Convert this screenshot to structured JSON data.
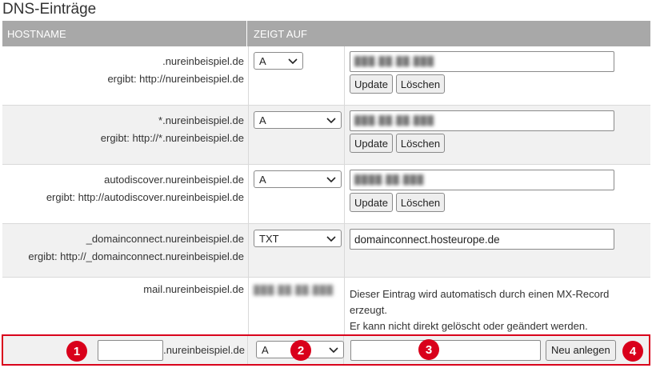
{
  "page": {
    "title": "DNS-Einträge"
  },
  "table": {
    "headers": {
      "hostname": "HOSTNAME",
      "target": "ZEIGT AUF"
    },
    "update_label": "Update",
    "delete_label": "Löschen",
    "rows": [
      {
        "hostname": ".nureinbeispiel.de",
        "result": "ergibt: http://nureinbeispiel.de",
        "type": "A",
        "value": "███.██.██.███"
      },
      {
        "hostname": "*.nureinbeispiel.de",
        "result": "ergibt: http://*.nureinbeispiel.de",
        "type": "A",
        "value": "███.██.██.███"
      },
      {
        "hostname": "autodiscover.nureinbeispiel.de",
        "result": "ergibt: http://autodiscover.nureinbeispiel.de",
        "type": "A",
        "value": "████.██.███"
      },
      {
        "hostname": "_domainconnect.nureinbeispiel.de",
        "result": "ergibt: http://_domainconnect.nureinbeispiel.de",
        "type": "TXT",
        "value": "domainconnect.hosteurope.de"
      }
    ],
    "mail_row": {
      "hostname": "mail.nureinbeispiel.de",
      "ip": "███.██.██.███",
      "info_line1": "Dieser Eintrag wird automatisch durch einen MX-Record",
      "info_line2": "erzeugt.",
      "info_line3": "Er kann nicht direkt gelöscht oder geändert werden."
    },
    "new_row": {
      "hostname_value": "",
      "domain_suffix": ".nureinbeispiel.de",
      "type": "A",
      "value": "",
      "create_label": "Neu anlegen"
    }
  },
  "badges": [
    "1",
    "2",
    "3",
    "4"
  ],
  "colors": {
    "header_bg": "#a8a8a8",
    "highlight": "#d9001b",
    "alt_row": "#f1f1f1"
  }
}
